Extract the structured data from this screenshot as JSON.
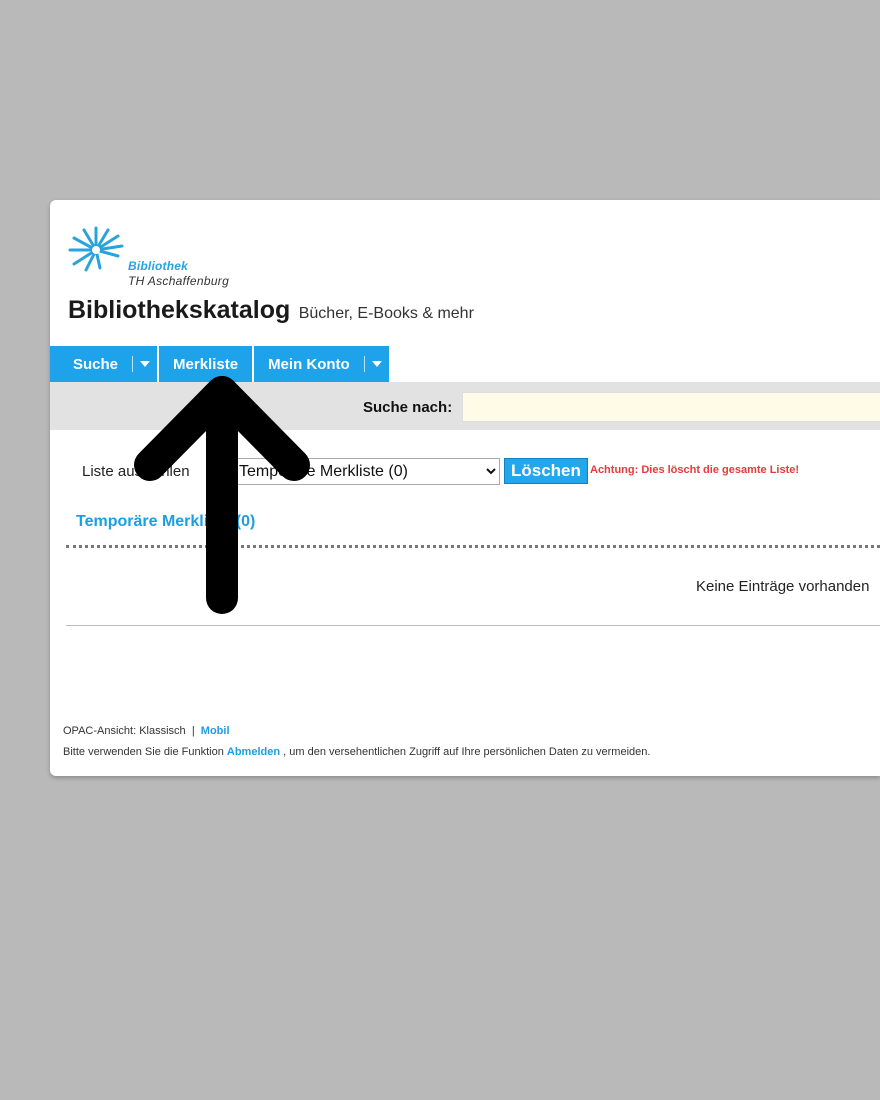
{
  "logo": {
    "line1": "Bibliothek",
    "line2": "TH Aschaffenburg"
  },
  "header": {
    "title": "Bibliothekskatalog",
    "subtitle": "Bücher, E-Books & mehr"
  },
  "nav": {
    "items": [
      "Suche",
      "Merkliste",
      "Mein Konto"
    ]
  },
  "search": {
    "label": "Suche nach:",
    "value": ""
  },
  "list": {
    "label": "Liste auswählen",
    "selected": "Temporäre Merkliste (0)",
    "delete_label": "Löschen",
    "warning": "Achtung: Dies löscht die gesamte Liste!"
  },
  "section": {
    "title": "Temporäre Merkliste (0)",
    "empty": "Keine Einträge vorhanden"
  },
  "footer": {
    "view_label": "OPAC-Ansicht:",
    "view_classic": "Klassisch",
    "separator": "|",
    "view_mobile": "Mobil",
    "note_before": "Bitte verwenden Sie die Funktion",
    "note_link": "Abmelden",
    "note_after": ", um den versehentlichen Zugriff auf Ihre persönlichen Daten zu vermeiden."
  },
  "colors": {
    "accent": "#1ea2ea",
    "warning": "#e53b3b",
    "background": "#b9b9b9"
  },
  "icons": {
    "nav_dropdown": "caret-down-icon",
    "overlay": "arrow-up-icon"
  }
}
